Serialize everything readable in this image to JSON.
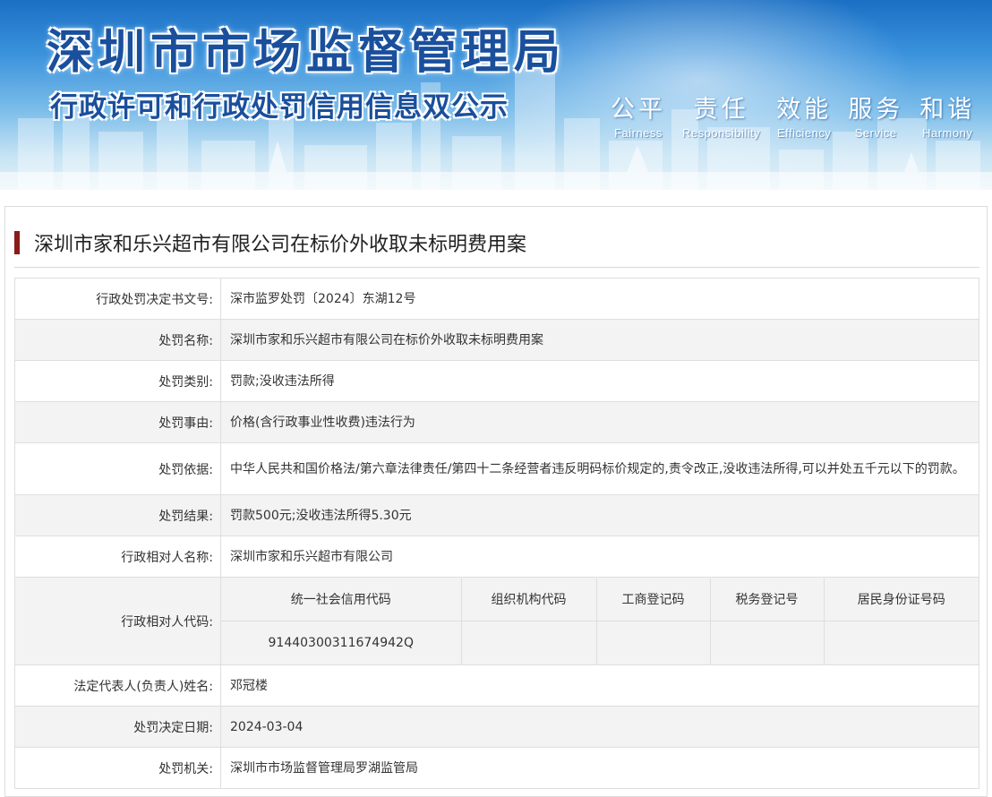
{
  "banner": {
    "title": "深圳市市场监督管理局",
    "subtitle": "行政许可和行政处罚信用信息双公示",
    "values": [
      {
        "cn": "公平",
        "en": "Fairness"
      },
      {
        "cn": "责任",
        "en": "Responsibility"
      },
      {
        "cn": "效能",
        "en": "Efficiency"
      },
      {
        "cn": "服务",
        "en": "Service"
      },
      {
        "cn": "和谐",
        "en": "Harmony"
      }
    ]
  },
  "case": {
    "title": "深圳市家和乐兴超市有限公司在标价外收取未标明费用案"
  },
  "fields": {
    "decision_no": {
      "label": "行政处罚决定书文号:",
      "value": "深市监罗处罚〔2024〕东湖12号"
    },
    "penalty_name": {
      "label": "处罚名称:",
      "value": "深圳市家和乐兴超市有限公司在标价外收取未标明费用案"
    },
    "penalty_type": {
      "label": "处罚类别:",
      "value": "罚款;没收违法所得"
    },
    "penalty_reason": {
      "label": "处罚事由:",
      "value": "价格(含行政事业性收费)违法行为"
    },
    "penalty_basis": {
      "label": "处罚依据:",
      "value": "中华人民共和国价格法/第六章法律责任/第四十二条经营者违反明码标价规定的,责令改正,没收违法所得,可以并处五千元以下的罚款。"
    },
    "penalty_result": {
      "label": "处罚结果:",
      "value": "罚款500元;没收违法所得5.30元"
    },
    "party_name": {
      "label": "行政相对人名称:",
      "value": "深圳市家和乐兴超市有限公司"
    },
    "party_codes": {
      "label": "行政相对人代码:",
      "headers": [
        "统一社会信用代码",
        "组织机构代码",
        "工商登记码",
        "税务登记号",
        "居民身份证号码"
      ],
      "values": [
        "91440300311674942Q",
        "",
        "",
        "",
        ""
      ]
    },
    "legal_rep": {
      "label": "法定代表人(负责人)姓名:",
      "value": "邓冠楼"
    },
    "decision_date": {
      "label": "处罚决定日期:",
      "value": "2024-03-04"
    },
    "authority": {
      "label": "处罚机关:",
      "value": "深圳市市场监督管理局罗湖监管局"
    }
  },
  "colors": {
    "accent_bar": "#8b1a1a",
    "banner_blue": "#1a4f9c",
    "row_alt": "#f3f3f3",
    "border": "#dedede"
  }
}
